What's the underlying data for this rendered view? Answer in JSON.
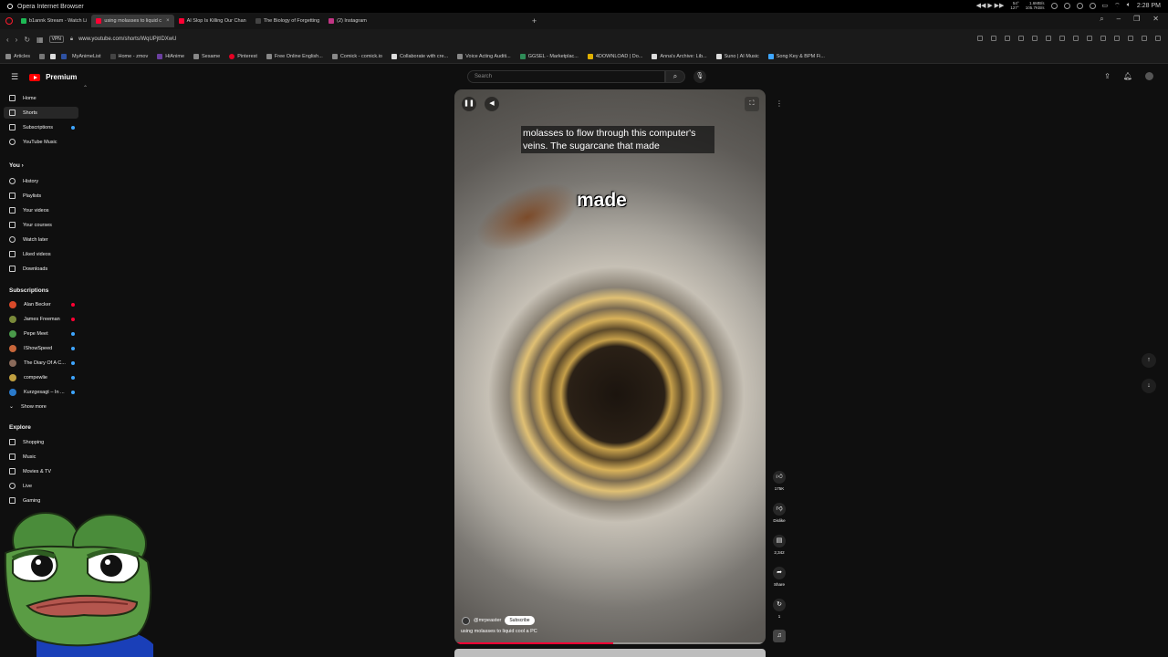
{
  "os": {
    "app_title": "Opera Internet Browser",
    "net_up": "1.6MB/s",
    "net_down": "105.7KB/s",
    "temp_top": "54°",
    "temp_bottom": "127°",
    "time": "2:28 PM"
  },
  "tabs": [
    {
      "label": "b1annk Stream - Watch Li",
      "color": "#1db954"
    },
    {
      "label": "using molasses to liquid c",
      "color": "#ff0033",
      "active": true
    },
    {
      "label": "AI Slop Is Killing Our Chan",
      "color": "#ff0033"
    },
    {
      "label": "The Biology of Forgetting",
      "color": "#444444"
    },
    {
      "label": "(2) Instagram",
      "color": "#c13584"
    }
  ],
  "address": {
    "vpn": "VPN",
    "url": "www.youtube.com/shorts/WqUPjtIDXwU"
  },
  "bookmarks": [
    {
      "label": "Articles",
      "color": "#888888"
    },
    {
      "label": "MyAnimeList",
      "color": "#2e51a2"
    },
    {
      "label": "Home - zmov",
      "color": "#444444"
    },
    {
      "label": "HiAnime",
      "color": "#6b3fa0"
    },
    {
      "label": "Sesame",
      "color": "#888888"
    },
    {
      "label": "Pinterest",
      "color": "#e60023"
    },
    {
      "label": "Free Online English...",
      "color": "#888888"
    },
    {
      "label": "Comick - comick.io",
      "color": "#888888"
    },
    {
      "label": "Collaborate with cre...",
      "color": "#dddddd"
    },
    {
      "label": "Voice Acting Auditi...",
      "color": "#888888"
    },
    {
      "label": "GGSEL - Marketplac...",
      "color": "#2e8b57"
    },
    {
      "label": "4DOWNLOAD | Do...",
      "color": "#e0b000"
    },
    {
      "label": "Anna's Archive: Lib...",
      "color": "#dddddd"
    },
    {
      "label": "Suno | AI Music",
      "color": "#dddddd"
    },
    {
      "label": "Song Key & BPM Fi...",
      "color": "#3ea6ff"
    }
  ],
  "yt": {
    "brand": "Premium",
    "search_placeholder": "Search"
  },
  "sidebar": {
    "main": [
      {
        "label": "Home"
      },
      {
        "label": "Shorts",
        "active": true
      },
      {
        "label": "Subscriptions",
        "live": true
      },
      {
        "label": "YouTube Music"
      }
    ],
    "you_heading": "You",
    "you_items": [
      {
        "label": "History"
      },
      {
        "label": "Playlists"
      },
      {
        "label": "Your videos"
      },
      {
        "label": "Your courses"
      },
      {
        "label": "Watch later"
      },
      {
        "label": "Liked videos"
      },
      {
        "label": "Downloads"
      }
    ],
    "subs_heading": "Subscriptions",
    "subs": [
      {
        "label": "Alan Becker",
        "color": "#d94a2a"
      },
      {
        "label": "James Freeman",
        "color": "#7a8a3a"
      },
      {
        "label": "Pepe Meet",
        "color": "#4a9a4a"
      },
      {
        "label": "IShowSpeed",
        "color": "#c8663a"
      },
      {
        "label": "The Diary Of A C...",
        "color": "#8a6a5a"
      },
      {
        "label": "compewlie",
        "color": "#c0a040"
      },
      {
        "label": "Kurzgesagt – In ...",
        "color": "#2a7acb"
      }
    ],
    "show_more": "Show more",
    "explore_heading": "Explore",
    "explore": [
      {
        "label": "Shopping"
      },
      {
        "label": "Music"
      },
      {
        "label": "Movies & TV"
      },
      {
        "label": "Live"
      },
      {
        "label": "Gaming"
      }
    ]
  },
  "video": {
    "caption": "molasses to flow through this computer's veins. The sugarcane that made",
    "big_word": "made",
    "channel": "@mrpeaster",
    "subscribe": "Subscribe",
    "title": "using molasses to liquid cool a PC",
    "progress": 0.51
  },
  "actions": {
    "likes": "175K",
    "dislike": "Dislike",
    "comments": "2,342",
    "share": "Share",
    "remix": "1"
  }
}
